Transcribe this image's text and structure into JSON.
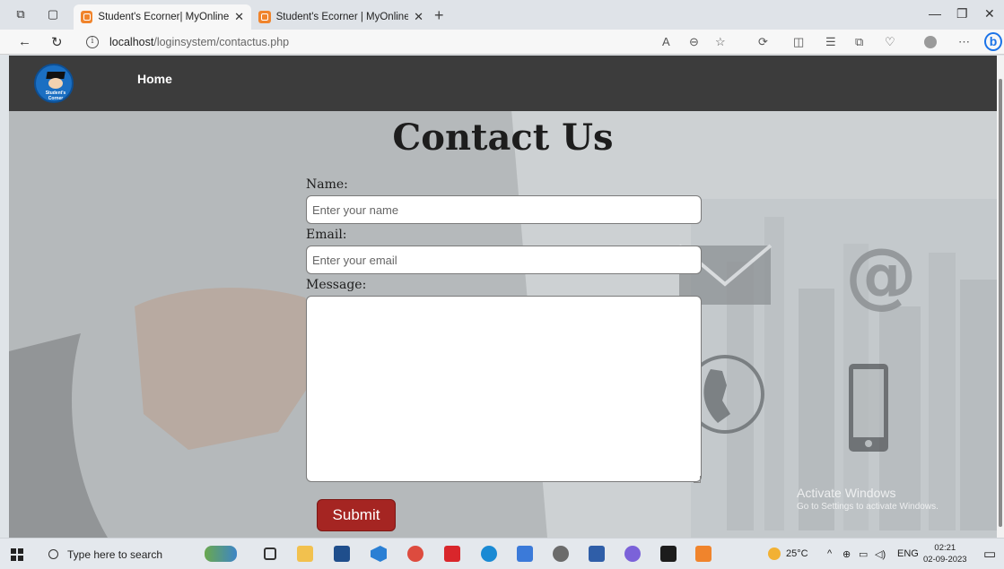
{
  "browser": {
    "tabs": [
      {
        "title": "Student's Ecorner| MyOnline.com",
        "active": true
      },
      {
        "title": "Student's Ecorner | MyOnlineMe",
        "active": false
      }
    ],
    "url_host": "localhost",
    "url_path": "/loginsystem/contactus.php"
  },
  "site": {
    "logo_text": "Student's Corner",
    "nav": {
      "home": "Home"
    }
  },
  "form": {
    "heading": "Contact Us",
    "name_label": "Name:",
    "name_placeholder": "Enter your name",
    "email_label": "Email:",
    "email_placeholder": "Enter your email",
    "message_label": "Message:",
    "submit_label": "Submit"
  },
  "watermark": {
    "title": "Activate Windows",
    "subtitle": "Go to Settings to activate Windows."
  },
  "taskbar": {
    "search_placeholder": "Type here to search",
    "temperature": "25°C",
    "language": "ENG",
    "time": "02:21",
    "date": "02-09-2023"
  },
  "colors": {
    "header_bg": "#3c3c3c",
    "submit_bg": "#a52522",
    "accent_blue": "#1b73e8"
  }
}
